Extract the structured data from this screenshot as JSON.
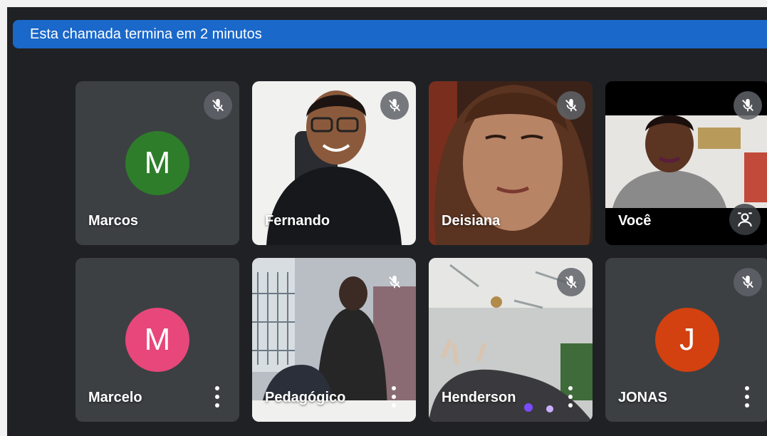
{
  "banner": {
    "text": "Esta chamada termina em 2 minutos"
  },
  "participants": [
    {
      "name": "Marcos",
      "initial": "M",
      "avatar_color": "#2e7d2a"
    },
    {
      "name": "Fernando"
    },
    {
      "name": "Deisiana"
    },
    {
      "name": "Você"
    },
    {
      "name": "Marcelo",
      "initial": "M",
      "avatar_color": "#e8477b"
    },
    {
      "name": "Pedagógico"
    },
    {
      "name": "Henderson"
    },
    {
      "name": "JONAS",
      "initial": "J",
      "avatar_color": "#d2410f"
    }
  ],
  "icons": {
    "mic_off": "mic-off-icon",
    "more": "more-vert-icon",
    "pin": "pin-person-icon"
  },
  "colors": {
    "background": "#202124",
    "tile": "#3c4043",
    "banner": "#1a68c9"
  }
}
